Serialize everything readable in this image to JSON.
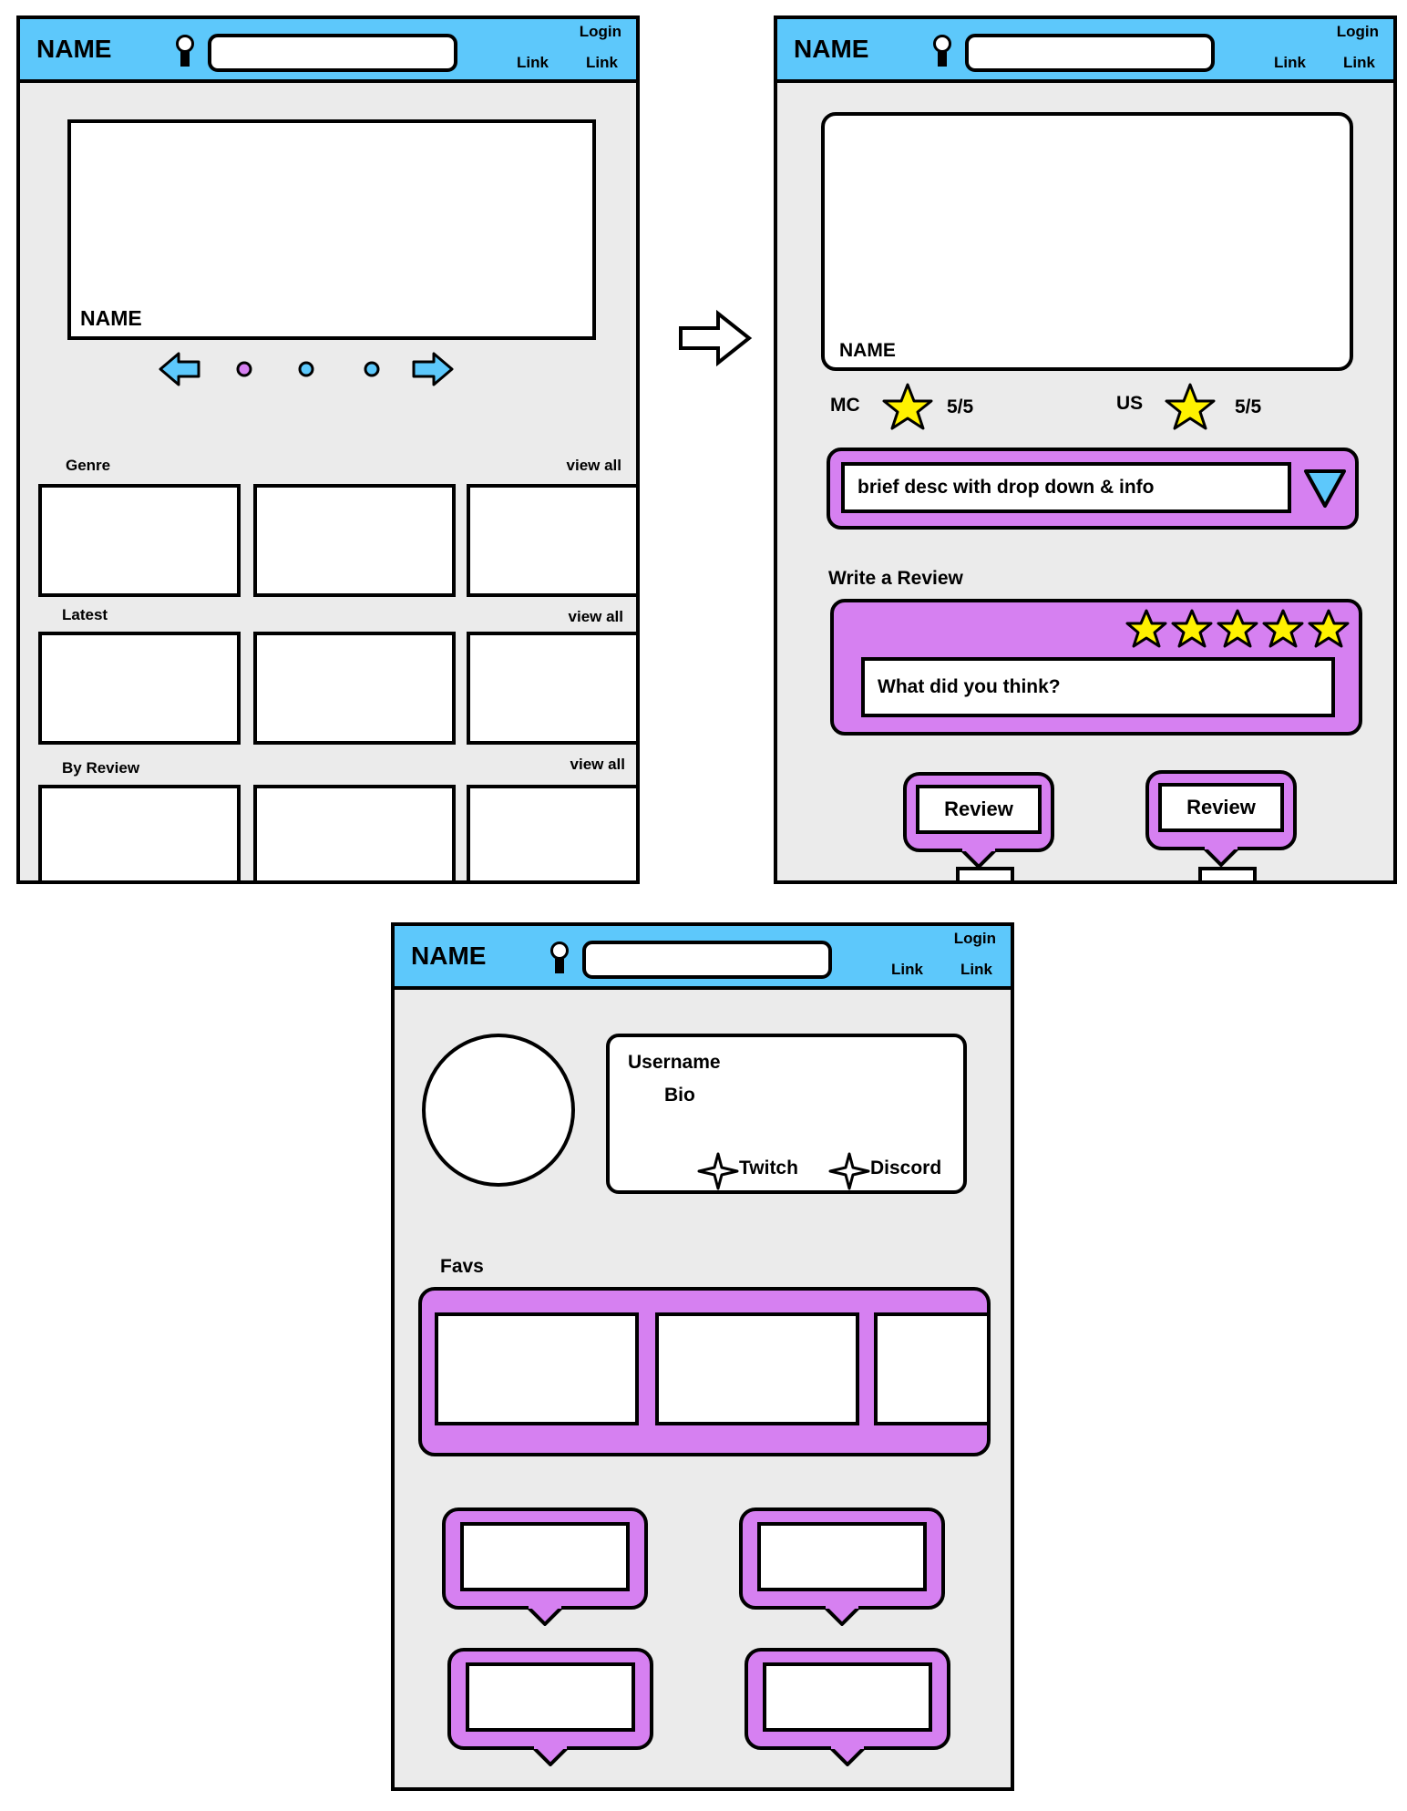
{
  "header": {
    "brand": "NAME",
    "login": "Login",
    "link1": "Link",
    "link2": "Link"
  },
  "home": {
    "hero_name": "NAME",
    "rows": [
      {
        "label": "Genre",
        "view_all": "view all"
      },
      {
        "label": "Latest",
        "view_all": "view all"
      },
      {
        "label": "By Review",
        "view_all": "view all"
      }
    ]
  },
  "detail": {
    "hero_name": "NAME",
    "mc_label": "MC",
    "mc_score": "5/5",
    "us_label": "US",
    "us_score": "5/5",
    "description": "brief desc with drop down & info",
    "write_review": "Write a Review",
    "review_placeholder": "What did you think?",
    "review_button_1": "Review",
    "review_button_2": "Review"
  },
  "profile": {
    "username": "Username",
    "bio": "Bio",
    "twitch": "Twitch",
    "discord": "Discord",
    "favs": "Favs"
  },
  "colors": {
    "header": "#5dc8fb",
    "accent": "#d680f1",
    "star": "#fff200",
    "panel": "#ebebeb"
  }
}
